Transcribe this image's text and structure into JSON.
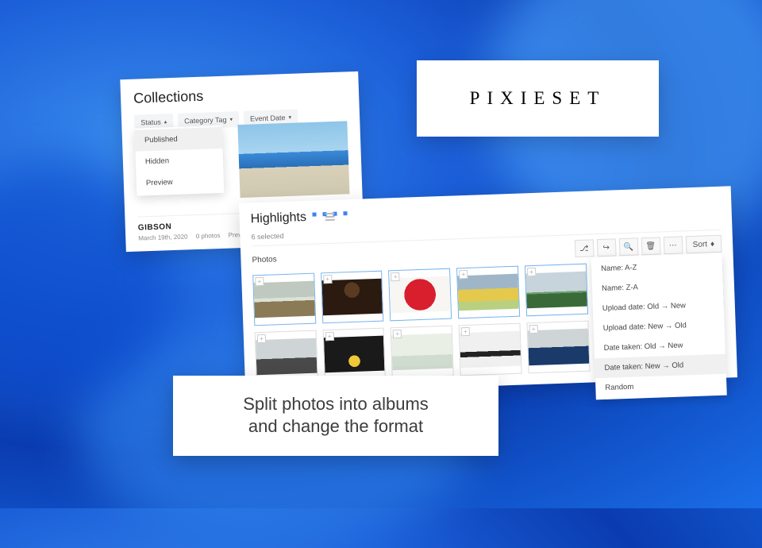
{
  "logo": "PIXIESET",
  "caption_line1": "Split photos into albums",
  "caption_line2": "and change the format",
  "collections": {
    "title": "Collections",
    "filters": {
      "status": "Status",
      "category": "Category Tag",
      "event": "Event Date"
    },
    "status_menu": [
      "Published",
      "Hidden",
      "Preview"
    ],
    "card": {
      "name": "GIBSON",
      "date": "March 19th, 2020",
      "count": "0 photos",
      "state": "Preview"
    }
  },
  "highlights": {
    "title": "Highlights",
    "selected": "6 selected",
    "photos_label": "Photos",
    "sort_label": "Sort",
    "sort_options": [
      "Name: A-Z",
      "Name: Z-A",
      "Upload date: Old → New",
      "Upload date: New → Old",
      "Date taken: Old → New",
      "Date taken: New → Old",
      "Random"
    ]
  }
}
